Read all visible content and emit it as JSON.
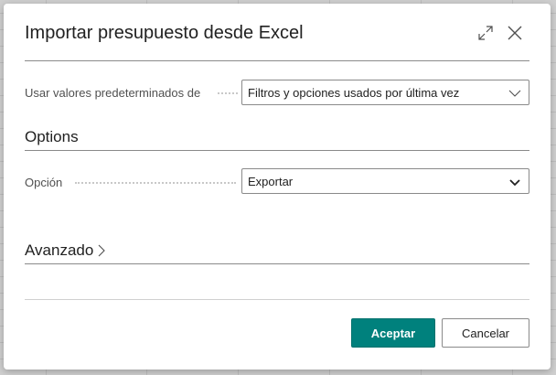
{
  "dialog": {
    "title": "Importar presupuesto desde Excel",
    "expand_icon": "expand-icon",
    "close_icon": "close-icon"
  },
  "defaults": {
    "label": "Usar valores predeterminados de",
    "value": "Filtros y opciones usados por última vez"
  },
  "options_section": {
    "title": "Options",
    "option_label": "Opción",
    "option_value": "Exportar"
  },
  "advanced_section": {
    "title": "Avanzado",
    "icon": "chevron-right-icon"
  },
  "footer": {
    "accept_label": "Aceptar",
    "cancel_label": "Cancelar"
  },
  "colors": {
    "accent": "#00817d",
    "text": "#212121",
    "label": "#505050"
  }
}
